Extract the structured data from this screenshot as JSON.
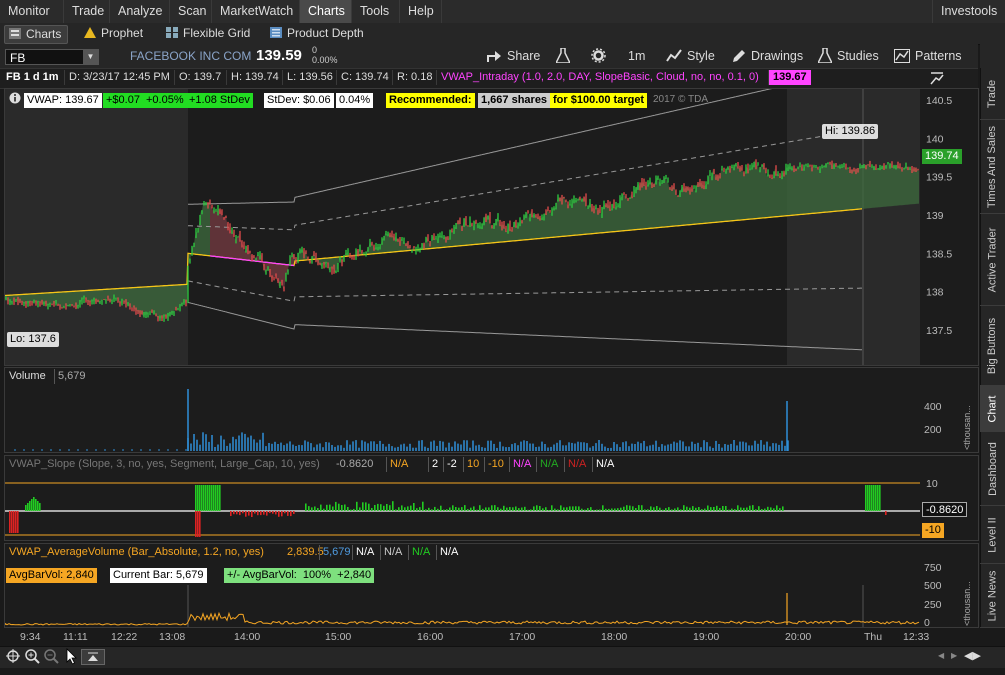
{
  "menu": {
    "items": [
      "Monitor",
      "Trade",
      "Analyze",
      "Scan",
      "MarketWatch",
      "Charts",
      "Tools",
      "Help"
    ],
    "brand": "Investools"
  },
  "subtabs": [
    "Charts",
    "Prophet",
    "Flexible Grid",
    "Product Depth"
  ],
  "toolbar": {
    "symbol": "FB",
    "company": "FACEBOOK INC COM",
    "price": "139.59",
    "change_top": "0",
    "change_bottom": "0.00%",
    "share": "Share",
    "interval": "1m",
    "style": "Style",
    "drawings": "Drawings",
    "studies": "Studies",
    "patterns": "Patterns"
  },
  "infobar": {
    "period": "FB 1 d 1m",
    "date": "D: 3/23/17 12:45 PM",
    "open": "O: 139.7",
    "high": "H: 139.74",
    "low": "L: 139.56",
    "close": "C: 139.74",
    "range": "R: 0.18",
    "study": "VWAP_Intraday (1.0, 2.0, DAY, SlopeBasic, Cloud, no, no, 0.1, 0)",
    "study_value": "139.67"
  },
  "price_panel": {
    "vwap": "VWAP: 139.67",
    "chg": "+$0.07",
    "chg_pct": "+0.05%",
    "stdev_mult": "+1.08 StDev",
    "stdev": "StDev: $0.06",
    "stdev_pct": "0.04%",
    "recommended": "Recommended:",
    "shares": "1,667 shares",
    "target": "for $100.00 target",
    "copyright": "2017 © TDA",
    "hi": "Hi: 139.86",
    "lo": "Lo: 137.6",
    "last": "139.74",
    "y_ticks": [
      "140.5",
      "140",
      "139.5",
      "139",
      "138.5",
      "138",
      "137.5"
    ]
  },
  "volume_panel": {
    "title": "Volume",
    "value": "5,679",
    "y_ticks": [
      "400",
      "200"
    ],
    "unit": "<thousan..."
  },
  "slope_panel": {
    "title": "VWAP_Slope (Slope, 3, no, yes, Segment, Large_Cap, 10, yes)",
    "value": "-0.8620",
    "cells": [
      "N/A",
      "2",
      "-2",
      "10",
      "-10",
      "N/A",
      "N/A",
      "N/A",
      "N/A"
    ],
    "y_ticks": [
      "10"
    ],
    "current": "-0.8620",
    "neg_tick": "-10"
  },
  "avgvol_panel": {
    "title": "VWAP_AverageVolume (Bar_Absolute, 1.2, no, yes)",
    "v1": "2,839.5",
    "v2": "5,679",
    "cells": [
      "N/A",
      "N/A",
      "N/A",
      "N/A"
    ],
    "avg": "AvgBarVol: 2,840",
    "current": "Current Bar: 5,679",
    "diff": "+/- AvgBarVol:  100%  +2,840",
    "y_ticks": [
      "750",
      "500",
      "250",
      "0"
    ],
    "unit": "<thousan..."
  },
  "xaxis": [
    "9:34",
    "11:11",
    "12:22",
    "13:08",
    "14:00",
    "15:00",
    "16:00",
    "17:00",
    "18:00",
    "19:00",
    "20:00",
    "Thu",
    "12:33"
  ],
  "sidetabs": [
    "Trade",
    "Times And Sales",
    "Active Trader",
    "Big Buttons",
    "Chart",
    "Dashboard",
    "Level II",
    "Live News"
  ],
  "colors": {
    "up": "#2ecc40",
    "down": "#e34b4b",
    "vwap": "#f5c518",
    "cloud": "#3d6b3d",
    "magenta": "#ff44ff",
    "yellow_bg": "#ffff00"
  }
}
